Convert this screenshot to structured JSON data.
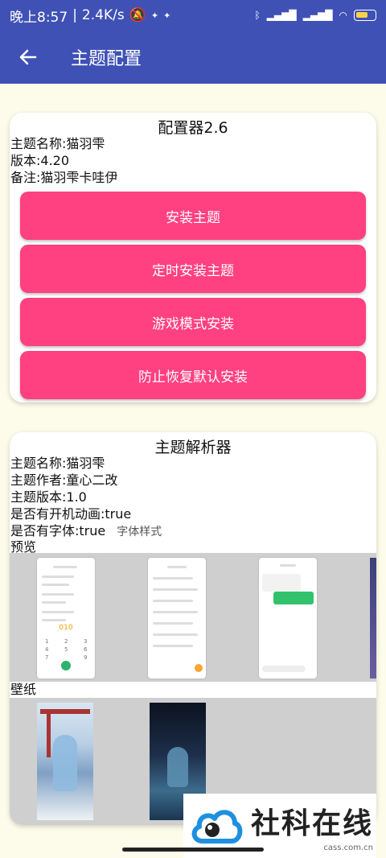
{
  "status": {
    "time": "晚上8:57",
    "speed": "2.4K/s",
    "battery_color": "#f7d34a"
  },
  "appbar": {
    "back_icon": "arrow-left-icon",
    "title": "主题配置",
    "color": "#3f51b5"
  },
  "configurator": {
    "title": "配置器2.6",
    "name": "主题名称:猫羽雫",
    "version": "版本:4.20",
    "note": "备注:猫羽雫卡哇伊",
    "buttons": [
      "安装主题",
      "定时安装主题",
      "游戏模式安装",
      "防止恢复默认安装"
    ],
    "button_color": "#ff4081"
  },
  "parser": {
    "title": "主题解析器",
    "name": "主题名称:猫羽雫",
    "author": "主题作者:童心二改",
    "version": "主题版本:1.0",
    "boot_anim": "是否有开机动画:true",
    "font": "是否有字体:true",
    "font_sample": "字体样式",
    "preview_label": "预览",
    "wallpaper_label": "壁纸",
    "dial_number": "010"
  },
  "watermark": {
    "title": "社科在线",
    "url": "cass.com.cn"
  }
}
